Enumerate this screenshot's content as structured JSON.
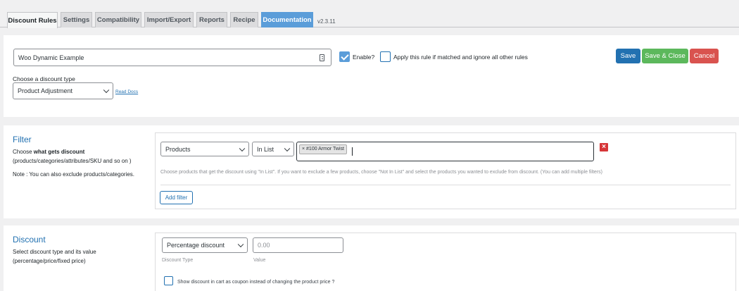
{
  "tabs": [
    {
      "label": "Discount Rules"
    },
    {
      "label": "Settings"
    },
    {
      "label": "Compatibility"
    },
    {
      "label": "Import/Export"
    },
    {
      "label": "Reports"
    },
    {
      "label": "Recipe"
    },
    {
      "label": "Documentation"
    }
  ],
  "version": "v2.3.11",
  "rule": {
    "name_value": "Woo Dynamic Example",
    "enable_label": "Enable?",
    "enable_checked": true,
    "apply_label": "Apply this rule if matched and ignore all other rules",
    "apply_checked": false,
    "discount_type_label": "Choose a discount type",
    "discount_type_value": "Product Adjustment",
    "read_docs": "Read Docs"
  },
  "actions": {
    "save": "Save",
    "save_close": "Save & Close",
    "cancel": "Cancel"
  },
  "filter": {
    "title": "Filter",
    "desc_prefix": "Choose ",
    "desc_bold": "what gets discount",
    "desc_line2": "(products/categories/attributes/SKU and so on )",
    "note": "Note : You can also exclude products/categories.",
    "type_value": "Products",
    "condition_value": "In List",
    "tag": "× #100 Armor Twist",
    "hint": "Choose products that get the discount using \"In List\". If you want to exclude a few products, choose \"Not In List\" and select the products you wanted to exclude from discount. (You can add multiple filters)",
    "add_filter": "Add filter"
  },
  "discount": {
    "title": "Discount",
    "desc_line1": "Select discount type and its value",
    "desc_line2": "(percentage/price/fixed price)",
    "type_value": "Percentage discount",
    "type_caption": "Discount Type",
    "value_placeholder": "0.00",
    "value_caption": "Value",
    "coupon_label": "Show discount in cart as coupon instead of changing the product price ?"
  },
  "colors": {
    "primary": "#2271b1",
    "success": "#5cb85c",
    "danger": "#d9534f",
    "tab_active": "#5b9dd9"
  }
}
